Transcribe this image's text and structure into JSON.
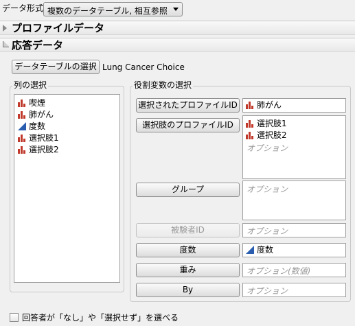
{
  "top": {
    "format_label": "データ形式",
    "format_value": "複数のデータテーブル, 相互参照"
  },
  "sections": {
    "profile_title": "プロファイルデータ",
    "response_title": "応答データ"
  },
  "response": {
    "select_table_button": "データテーブルの選択",
    "table_name": "Lung Cancer Choice"
  },
  "columns": {
    "caption": "列の選択",
    "items": [
      {
        "label": "喫煙",
        "icon": "nominal-icon"
      },
      {
        "label": "肺がん",
        "icon": "nominal-icon"
      },
      {
        "label": "度数",
        "icon": "continuous-icon"
      },
      {
        "label": "選択肢1",
        "icon": "nominal-icon"
      },
      {
        "label": "選択肢2",
        "icon": "nominal-icon"
      }
    ]
  },
  "roles": {
    "caption": "役割変数の選択",
    "selected_profile_id": {
      "button": "選択されたプロファイルID",
      "value": "肺がん"
    },
    "choice_profile_id": {
      "button": "選択肢のプロファイルID",
      "values": [
        "選択肢1",
        "選択肢2"
      ],
      "placeholder": "オプション"
    },
    "group": {
      "button": "グループ",
      "placeholder": "オプション"
    },
    "subject_id": {
      "button": "被験者ID",
      "placeholder": "オプション"
    },
    "freq": {
      "button": "度数",
      "value": "度数"
    },
    "weight": {
      "button": "重み",
      "placeholder": "オプション(数値)"
    },
    "by": {
      "button": "By",
      "placeholder": "オプション"
    }
  },
  "options": {
    "none_choice_label": "回答者が「なし」や「選択せず」を選べる",
    "none_choice_checked": false
  },
  "colors": {
    "nominal": "#c0392b",
    "continuous": "#2a5db0"
  }
}
